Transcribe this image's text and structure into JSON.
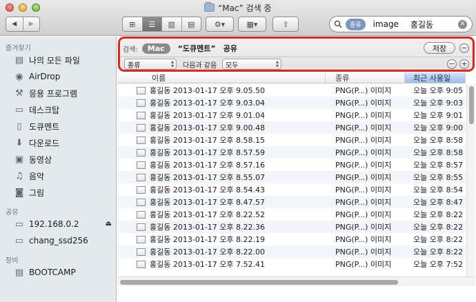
{
  "window": {
    "title": "“Mac” 검색 중"
  },
  "toolbar": {
    "back_icon": "chevron-left-icon",
    "forward_icon": "chevron-right-icon",
    "back_glyph": "◀",
    "forward_glyph": "▶",
    "view_icons": [
      "⊞",
      "☰",
      "▥",
      "▤"
    ],
    "action_glyph": "⚙▾",
    "arrange_glyph": "▦▾",
    "share_glyph": "⇪"
  },
  "search": {
    "token": "종류",
    "text1": "image",
    "text2": "홍길동"
  },
  "sidebar": {
    "sections": [
      {
        "title": "즐겨찾기",
        "items": [
          {
            "label": "나의 모든 파일",
            "icon": "all-my-files-icon",
            "glyph": "▤"
          },
          {
            "label": "AirDrop",
            "icon": "airdrop-icon",
            "glyph": "◉"
          },
          {
            "label": "응용 프로그램",
            "icon": "applications-icon",
            "glyph": "⚒"
          },
          {
            "label": "데스크탑",
            "icon": "desktop-icon",
            "glyph": "▭"
          },
          {
            "label": "도큐멘트",
            "icon": "documents-icon",
            "glyph": "▯"
          },
          {
            "label": "다운로드",
            "icon": "downloads-icon",
            "glyph": "⬇"
          },
          {
            "label": "동영상",
            "icon": "movies-icon",
            "glyph": "▣"
          },
          {
            "label": "음악",
            "icon": "music-icon",
            "glyph": "♫"
          },
          {
            "label": "그림",
            "icon": "pictures-icon",
            "glyph": "◙"
          }
        ]
      },
      {
        "title": "공유",
        "items": [
          {
            "label": "192.168.0.2",
            "icon": "server-icon",
            "glyph": "▭"
          },
          {
            "label": "chang_ssd256",
            "icon": "server-icon",
            "glyph": "▭"
          }
        ]
      },
      {
        "title": "장비",
        "items": [
          {
            "label": "BOOTCAMP",
            "icon": "disk-icon",
            "glyph": "▤"
          }
        ]
      }
    ],
    "eject_glyph": "⏏"
  },
  "search_bar": {
    "label": "검색:",
    "scopes": [
      "Mac",
      "“도큐멘트”",
      "공유"
    ],
    "active_scope": "Mac",
    "save_label": "저장",
    "remove_glyph": "−",
    "add_glyph": "+",
    "criteria_attr": "종류",
    "criteria_match": "다음과 같음",
    "criteria_value": "모두"
  },
  "columns": {
    "name": "이름",
    "kind": "종류",
    "date": "최근 사용일"
  },
  "files": [
    {
      "name": "홍길동 2013-01-17 오후 9.05.50",
      "kind": "PNG(P...) 이미지",
      "date": "오늘 오후 9:05"
    },
    {
      "name": "홍길동 2013-01-17 오후 9.03.04",
      "kind": "PNG(P...) 이미지",
      "date": "오늘 오후 9:03"
    },
    {
      "name": "홍길동 2013-01-17 오후 9.01.04",
      "kind": "PNG(P...) 이미지",
      "date": "오늘 오후 9:01"
    },
    {
      "name": "홍길동 2013-01-17 오후 9.00.48",
      "kind": "PNG(P...) 이미지",
      "date": "오늘 오후 9:00"
    },
    {
      "name": "홍길동 2013-01-17 오후 8.58.15",
      "kind": "PNG(P...) 이미지",
      "date": "오늘 오후 8:58"
    },
    {
      "name": "홍길동 2013-01-17 오후 8.57.59",
      "kind": "PNG(P...) 이미지",
      "date": "오늘 오후 8:58"
    },
    {
      "name": "홍길동 2013-01-17 오후 8.57.16",
      "kind": "PNG(P...) 이미지",
      "date": "오늘 오후 8:57"
    },
    {
      "name": "홍길동 2013-01-17 오후 8.55.07",
      "kind": "PNG(P...) 이미지",
      "date": "오늘 오후 8:55"
    },
    {
      "name": "홍길동 2013-01-17 오후 8.54.43",
      "kind": "PNG(P...) 이미지",
      "date": "오늘 오후 8:54"
    },
    {
      "name": "홍길동 2013-01-17 오후 8.47.57",
      "kind": "PNG(P...) 이미지",
      "date": "오늘 오후 8:47"
    },
    {
      "name": "홍길동 2013-01-17 오후 8.22.52",
      "kind": "PNG(P...) 이미지",
      "date": "오늘 오후 8:22"
    },
    {
      "name": "홍길동 2013-01-17 오후 8.22.36",
      "kind": "PNG(P...) 이미지",
      "date": "오늘 오후 8:22"
    },
    {
      "name": "홍길동 2013-01-17 오후 8.22.19",
      "kind": "PNG(P...) 이미지",
      "date": "오늘 오후 8:22"
    },
    {
      "name": "홍길동 2013-01-17 오후 8.22.00",
      "kind": "PNG(P...) 이미지",
      "date": "오늘 오후 8:22"
    },
    {
      "name": "홍길동 2013-01-17 오후 7.52.41",
      "kind": "PNG(P...) 이미지",
      "date": "오늘 오후 7:52"
    }
  ],
  "colors": {
    "highlight_border": "#e4231a",
    "sidebar_bg": "#e4e9ef",
    "sorted_column": "#9fbde3"
  }
}
